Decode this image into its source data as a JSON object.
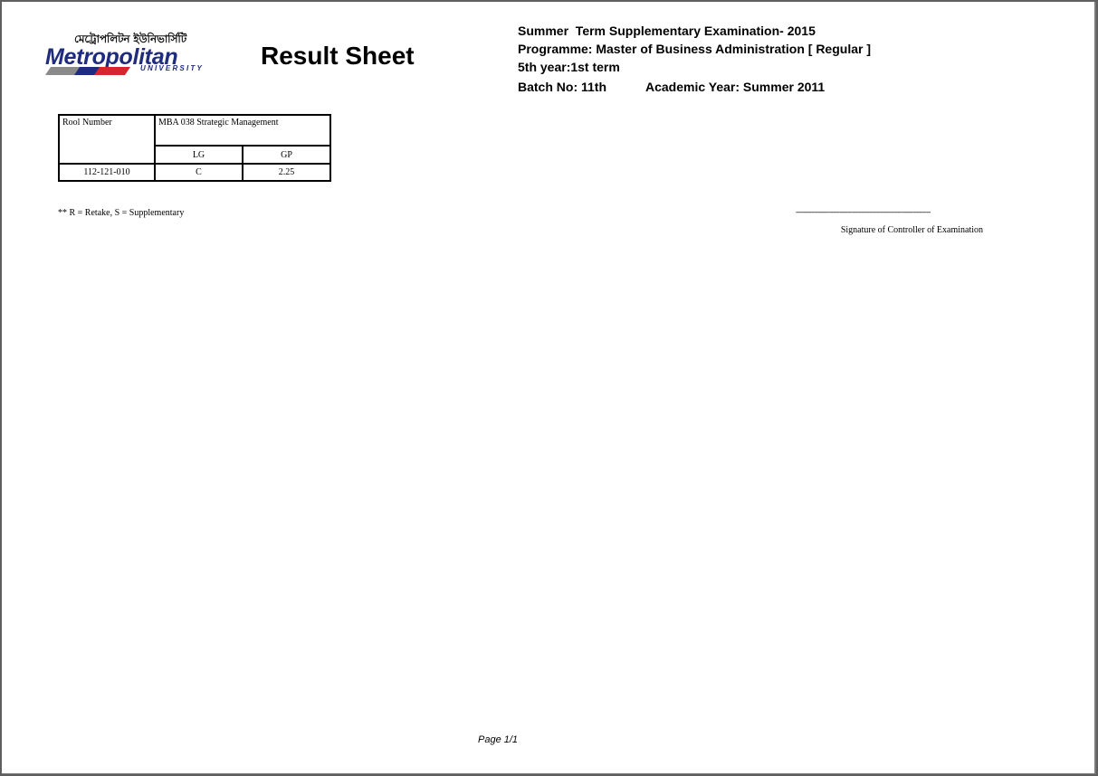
{
  "logo": {
    "bangla": "মেট্রোপলিটন ইউনিভার্সিটি",
    "name": "Metropolitan",
    "sub": "UNIVERSITY",
    "colors": {
      "navy": "#1f2c7e",
      "red": "#d9232d",
      "gray": "#8a8a8a"
    }
  },
  "title": "Result Sheet",
  "header": {
    "exam": "Summer  Term Supplementary Examination- 2015",
    "programme": "Programme: Master of Business Administration [ Regular ]",
    "year_term": "5th year:1st term",
    "batch": "Batch No: 11th",
    "academic_year": "Academic Year: Summer 2011"
  },
  "table": {
    "roll_header": "Rool Number",
    "course": "MBA 038 Strategic Management",
    "sub_headers": [
      "LG",
      "GP"
    ],
    "rows": [
      {
        "roll": "112-121-010",
        "lg": "C",
        "gp": "2.25"
      }
    ]
  },
  "note": "** R = Retake, S = Supplementary",
  "signature": {
    "line": "--------------------------------------------------------------",
    "label": "Signature of Controller of Examination"
  },
  "footer": {
    "page": "Page 1/1"
  }
}
